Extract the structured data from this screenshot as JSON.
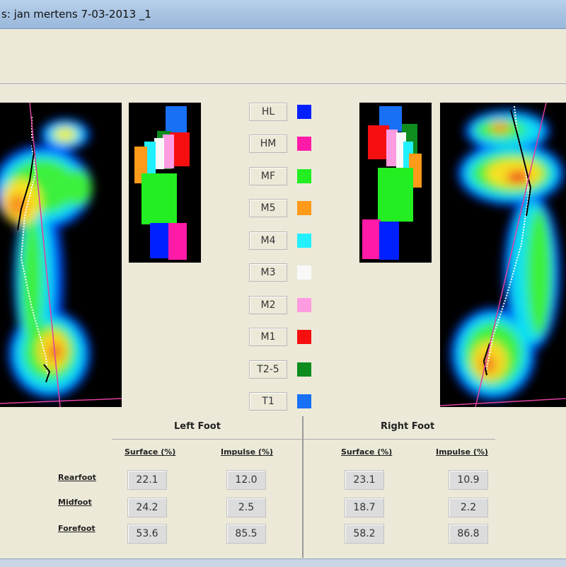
{
  "window": {
    "title": "s: jan mertens 7-03-2013 _1"
  },
  "legend": [
    {
      "label": "HL",
      "color": "#0020ff"
    },
    {
      "label": "HM",
      "color": "#ff1aa8"
    },
    {
      "label": "MF",
      "color": "#22ee22"
    },
    {
      "label": "M5",
      "color": "#ff9a1a"
    },
    {
      "label": "M4",
      "color": "#22f0ff"
    },
    {
      "label": "M3",
      "color": "#f8f8f8"
    },
    {
      "label": "M2",
      "color": "#ff9be0"
    },
    {
      "label": "M1",
      "color": "#f50f0f"
    },
    {
      "label": "T2-5",
      "color": "#0e8c1e"
    },
    {
      "label": "T1",
      "color": "#1870f5"
    }
  ],
  "results": {
    "left_title": "Left Foot",
    "right_title": "Right Foot",
    "surface_label": "Surface (%)",
    "impulse_label": "Impulse (%)",
    "rows": [
      {
        "label": "Rearfoot",
        "left_surface": "22.1",
        "left_impulse": "12.0",
        "right_surface": "23.1",
        "right_impulse": "10.9"
      },
      {
        "label": "Midfoot",
        "left_surface": "24.2",
        "left_impulse": "2.5",
        "right_surface": "18.7",
        "right_impulse": "2.2"
      },
      {
        "label": "Forefoot",
        "left_surface": "53.6",
        "left_impulse": "85.5",
        "right_surface": "58.2",
        "right_impulse": "86.8"
      }
    ]
  }
}
